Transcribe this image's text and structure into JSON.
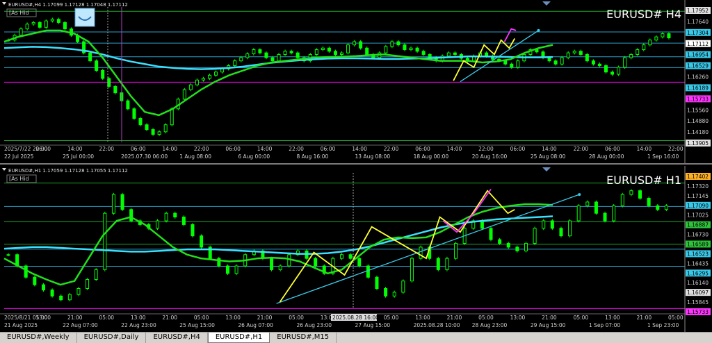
{
  "colors": {
    "background": "#000000",
    "candle": "#00ff00",
    "ma_fast": "#22e01a",
    "ma_slow": "#3ce0ff",
    "trend_line": "#3cc8e6",
    "zigzag": "#ffff33",
    "zigzag_alt": "#ff33ff",
    "level_green": "#1fa82a",
    "level_cyan": "#2a9ec8",
    "level_magenta": "#ff00ff",
    "grid_text": "#d0d0d0"
  },
  "icons": {
    "hide_toggle": "square-toggle-icon",
    "indicator_badge": "smile-arc-icon",
    "panel_marker": "triangle-down-icon"
  },
  "charts": [
    {
      "id": "h4",
      "header": "EURUSD#,H4  1.17099 1.17128 1.17048 1.17112",
      "symbol_label": "EURUSD# H4",
      "hide_label": "[As Hid",
      "x_labels": [
        "2025/7/22 22:00",
        "06:00",
        "14:00",
        "22:00",
        "06:00",
        "14:00",
        "22:00",
        "06:00",
        "14:00",
        "22:00",
        "06:00",
        "14:00",
        "22:00",
        "06:00",
        "14:00",
        "22:00",
        "06:00",
        "14:00",
        "22:00",
        "06:00",
        "14:00",
        "22:00"
      ],
      "x_labels_lower": [
        "22 Jul 2025",
        "25 Jul 00:00",
        "2025.07.30 06:00",
        "1 Aug 08:00",
        "6 Aug 00:00",
        "8 Aug 16:00",
        "13 Aug 08:00",
        "18 Aug 00:00",
        "20 Aug 16:00",
        "25 Aug 08:00",
        "28 Aug 00:00",
        "1 Sep 16:00"
      ],
      "price_range": [
        1.1385,
        1.18
      ],
      "price_labels": [
        {
          "text": "1.17952",
          "style": "box"
        },
        {
          "text": "1.17640",
          "style": "plain"
        },
        {
          "text": "1.17304",
          "style": "box-cyan"
        },
        {
          "text": "1.17112",
          "style": "box-white"
        },
        {
          "text": "1.16954",
          "style": "box-cyan"
        },
        {
          "text": "1.16529",
          "style": "box-cyan"
        },
        {
          "text": "1.16260",
          "style": "plain"
        },
        {
          "text": "1.16189",
          "style": "box-cyan"
        },
        {
          "text": "1.15733",
          "style": "box-magenta"
        },
        {
          "text": "1.15560",
          "style": "plain"
        },
        {
          "text": "1.14880",
          "style": "plain"
        },
        {
          "text": "1.14180",
          "style": "plain"
        },
        {
          "text": "1.13905",
          "style": "box"
        }
      ],
      "levels": [
        {
          "price": 1.17952,
          "color": "level_green"
        },
        {
          "price": 1.17304,
          "color": "level_cyan"
        },
        {
          "price": 1.16954,
          "color": "level_cyan"
        },
        {
          "price": 1.16529,
          "color": "level_cyan"
        },
        {
          "price": 1.16189,
          "color": "level_cyan"
        },
        {
          "price": 1.15733,
          "color": "level_magenta"
        },
        {
          "price": 1.13905,
          "color": "level_green"
        }
      ],
      "candle_closes": [
        1.1705,
        1.172,
        1.174,
        1.1755,
        1.176,
        1.1745,
        1.1765,
        1.177,
        1.176,
        1.174,
        1.172,
        1.17,
        1.1665,
        1.164,
        1.161,
        1.1585,
        1.156,
        1.154,
        1.1515,
        1.149,
        1.146,
        1.144,
        1.1425,
        1.141,
        1.1418,
        1.144,
        1.149,
        1.152,
        1.155,
        1.1565,
        1.158,
        1.1585,
        1.1595,
        1.1605,
        1.1615,
        1.1625,
        1.164,
        1.165,
        1.1662,
        1.1675,
        1.1665,
        1.165,
        1.164,
        1.166,
        1.167,
        1.1665,
        1.165,
        1.164,
        1.166,
        1.1675,
        1.168,
        1.167,
        1.166,
        1.1665,
        1.169,
        1.17,
        1.168,
        1.166,
        1.165,
        1.1665,
        1.1685,
        1.17,
        1.169,
        1.1675,
        1.168,
        1.167,
        1.166,
        1.165,
        1.164,
        1.1655,
        1.1665,
        1.166,
        1.1648,
        1.164,
        1.1655,
        1.1665,
        1.1655,
        1.1645,
        1.164,
        1.163,
        1.162,
        1.164,
        1.166,
        1.1675,
        1.1668,
        1.165,
        1.164,
        1.163,
        1.165,
        1.1665,
        1.167,
        1.166,
        1.164,
        1.163,
        1.1625,
        1.1605,
        1.1598,
        1.162,
        1.165,
        1.166,
        1.1675,
        1.169,
        1.1705,
        1.1715,
        1.1725,
        1.1712
      ],
      "ma_fast": [
        1.17,
        1.1715,
        1.1725,
        1.1735,
        1.1735,
        1.1725,
        1.17,
        1.165,
        1.159,
        1.153,
        1.148,
        1.147,
        1.149,
        1.152,
        1.155,
        1.1575,
        1.1595,
        1.161,
        1.1625,
        1.1635,
        1.164,
        1.1645,
        1.165,
        1.1652,
        1.1653,
        1.1655,
        1.1658,
        1.166,
        1.1655,
        1.165,
        1.1645,
        1.164,
        1.164,
        1.164,
        1.1635,
        1.1638,
        1.1645,
        1.1665,
        1.168,
        1.169
      ],
      "ma_slow": [
        1.168,
        1.1682,
        1.1684,
        1.1683,
        1.168,
        1.1676,
        1.167,
        1.166,
        1.1648,
        1.1638,
        1.163,
        1.1622,
        1.1618,
        1.1615,
        1.1614,
        1.1615,
        1.1618,
        1.1622,
        1.1628,
        1.1634,
        1.1638,
        1.1642,
        1.1645,
        1.1647,
        1.1648,
        1.1648,
        1.1647,
        1.1646,
        1.1646,
        1.1647,
        1.1648,
        1.165,
        1.1652,
        1.1654,
        1.1654,
        1.1653,
        1.1652,
        1.1651,
        1.1651,
        1.1652
      ],
      "trend": [
        [
          0.67,
          1.1575
        ],
        [
          0.785,
          1.1735
        ]
      ],
      "zigzag": [
        [
          0.66,
          1.1578
        ],
        [
          0.675,
          1.164
        ],
        [
          0.69,
          1.162
        ],
        [
          0.705,
          1.169
        ],
        [
          0.72,
          1.166
        ],
        [
          0.73,
          1.1705
        ],
        [
          0.742,
          1.168
        ],
        [
          0.75,
          1.171
        ]
      ],
      "zigzag_alt": [
        [
          0.735,
          1.17
        ],
        [
          0.745,
          1.174
        ],
        [
          0.752,
          1.1735
        ]
      ]
    },
    {
      "id": "h1",
      "header": "EURUSD#,H1  1.17059 1.17128 1.17055 1.17112",
      "symbol_label": "EURUSD# H1",
      "hide_label": "[As Hid",
      "x_labels": [
        "2025/8/21 05:00",
        "13:00",
        "21:00",
        "05:00",
        "13:00",
        "21:00",
        "05:00",
        "13:00",
        "21:00",
        "05:00",
        "13:00",
        "21:00",
        "05:00",
        "13:00",
        "21:00",
        "05:00",
        "13:00",
        "21:00",
        "05:00",
        "13:00",
        "21:00",
        "05:00"
      ],
      "x_labels_lower": [
        "21 Aug 2025",
        "22 Aug 07:00",
        "22 Aug 23:00",
        "25 Aug 15:00",
        "26 Aug 07:00",
        "26 Aug 23:00",
        "27 Aug 15:00",
        "2025.08.28 10:00",
        "28 Aug 23:00",
        "29 Aug 15:00",
        "1 Sep 07:00",
        "1 Sep 23:00"
      ],
      "crosshair_time": "2025.08.28 16:00",
      "price_range": [
        1.157,
        1.175
      ],
      "price_labels": [
        {
          "text": "1.17402",
          "style": "box-orange"
        },
        {
          "text": "1.17320",
          "style": "plain"
        },
        {
          "text": "1.17145",
          "style": "plain"
        },
        {
          "text": "1.17090",
          "style": "box-cyan"
        },
        {
          "text": "1.17025",
          "style": "plain"
        },
        {
          "text": "1.16887",
          "style": "box-green"
        },
        {
          "text": "1.16730",
          "style": "plain"
        },
        {
          "text": "1.16589",
          "style": "box-green"
        },
        {
          "text": "1.16523",
          "style": "box-cyan"
        },
        {
          "text": "1.16435",
          "style": "plain"
        },
        {
          "text": "1.16295",
          "style": "box-cyan"
        },
        {
          "text": "1.16140",
          "style": "plain"
        },
        {
          "text": "1.16097",
          "style": "box"
        },
        {
          "text": "1.15845",
          "style": "plain"
        },
        {
          "text": "1.15733",
          "style": "box-magenta"
        }
      ],
      "levels": [
        {
          "price": 1.17402,
          "color": "level_green"
        },
        {
          "price": 1.1709,
          "color": "level_cyan"
        },
        {
          "price": 1.16887,
          "color": "level_green"
        },
        {
          "price": 1.16589,
          "color": "level_green"
        },
        {
          "price": 1.16523,
          "color": "level_cyan"
        },
        {
          "price": 1.16295,
          "color": "level_cyan"
        },
        {
          "price": 1.15733,
          "color": "level_magenta"
        }
      ],
      "candle_closes": [
        1.1645,
        1.163,
        1.1615,
        1.1605,
        1.1598,
        1.159,
        1.1585,
        1.1592,
        1.16,
        1.1612,
        1.1625,
        1.17,
        1.1725,
        1.1705,
        1.169,
        1.1685,
        1.168,
        1.169,
        1.17,
        1.1695,
        1.1685,
        1.167,
        1.1655,
        1.164,
        1.163,
        1.162,
        1.163,
        1.1645,
        1.165,
        1.164,
        1.1625,
        1.163,
        1.1645,
        1.165,
        1.164,
        1.163,
        1.162,
        1.164,
        1.1645,
        1.164,
        1.163,
        1.1615,
        1.16,
        1.159,
        1.1595,
        1.161,
        1.164,
        1.1655,
        1.164,
        1.1625,
        1.164,
        1.166,
        1.168,
        1.169,
        1.168,
        1.1665,
        1.166,
        1.1655,
        1.165,
        1.166,
        1.168,
        1.169,
        1.168,
        1.167,
        1.169,
        1.171,
        1.1715,
        1.17,
        1.169,
        1.171,
        1.1725,
        1.173,
        1.172,
        1.171,
        1.1705,
        1.171
      ],
      "ma_fast": [
        1.164,
        1.163,
        1.162,
        1.1612,
        1.1605,
        1.161,
        1.164,
        1.167,
        1.169,
        1.1695,
        1.1685,
        1.167,
        1.1655,
        1.1645,
        1.164,
        1.1638,
        1.1636,
        1.1637,
        1.164,
        1.1641,
        1.164,
        1.1636,
        1.1628,
        1.162,
        1.1625,
        1.164,
        1.1655,
        1.1665,
        1.1668,
        1.1667,
        1.1668,
        1.1675,
        1.1685,
        1.1695,
        1.1702,
        1.1707,
        1.171,
        1.1712,
        1.1712,
        1.1711
      ],
      "ma_slow": [
        1.1653,
        1.1654,
        1.1655,
        1.1655,
        1.1654,
        1.1653,
        1.1652,
        1.1651,
        1.165,
        1.1649,
        1.1649,
        1.165,
        1.1651,
        1.1652,
        1.1652,
        1.1652,
        1.1651,
        1.165,
        1.1649,
        1.1648,
        1.1647,
        1.1646,
        1.1646,
        1.1647,
        1.1649,
        1.1652,
        1.1656,
        1.1661,
        1.1666,
        1.1671,
        1.1676,
        1.1681,
        1.1685,
        1.1688,
        1.169,
        1.1692,
        1.1693,
        1.1694,
        1.1695,
        1.1696
      ],
      "trend": [
        [
          0.4,
          1.158
        ],
        [
          0.845,
          1.1725
        ]
      ],
      "zigzag": [
        [
          0.405,
          1.1582
        ],
        [
          0.455,
          1.1648
        ],
        [
          0.5,
          1.1618
        ],
        [
          0.54,
          1.1682
        ],
        [
          0.62,
          1.164
        ],
        [
          0.64,
          1.1695
        ],
        [
          0.67,
          1.1675
        ],
        [
          0.71,
          1.173
        ],
        [
          0.74,
          1.17
        ],
        [
          0.75,
          1.1705
        ]
      ],
      "zigzag_alt": [
        [
          0.645,
          1.169
        ],
        [
          0.665,
          1.1675
        ],
        [
          0.69,
          1.17
        ],
        [
          0.715,
          1.1732
        ]
      ]
    }
  ],
  "tabs": [
    {
      "label": "EURUSD#,Weekly",
      "active": false
    },
    {
      "label": "EURUSD#,Daily",
      "active": false
    },
    {
      "label": "EURUSD#,H4",
      "active": false
    },
    {
      "label": "EURUSD#,H1",
      "active": true
    },
    {
      "label": "EURUSD#,M15",
      "active": false
    }
  ]
}
